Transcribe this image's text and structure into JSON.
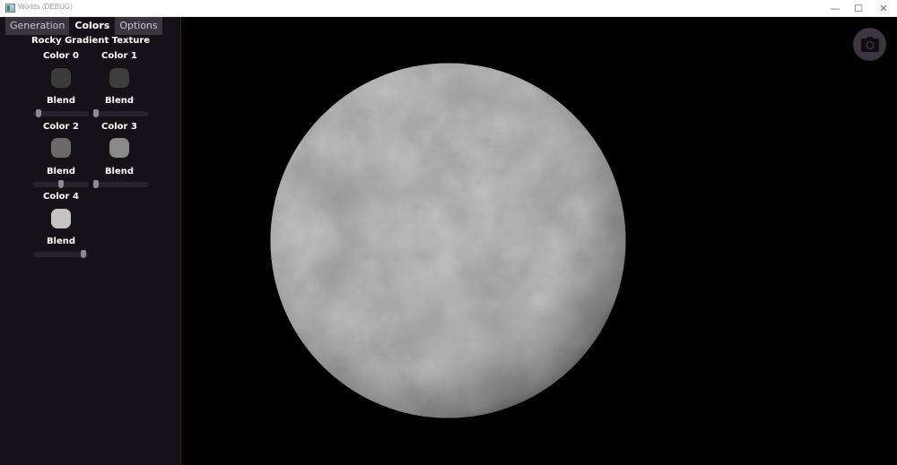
{
  "window": {
    "title": "Worlds (DEBUG)",
    "minimize_glyph": "—",
    "maximize_glyph": "☐",
    "close_glyph": "✕"
  },
  "tabs": [
    {
      "label": "Generation",
      "active": false
    },
    {
      "label": "Colors",
      "active": true
    },
    {
      "label": "Options",
      "active": false
    }
  ],
  "panel": {
    "title": "Rocky Gradient Texture",
    "colors": [
      {
        "label": "Color 0",
        "swatch": "#3a3a3a",
        "blend_label": "Blend",
        "blend": 0.05
      },
      {
        "label": "Color 1",
        "swatch": "#3d3d3d",
        "blend_label": "Blend",
        "blend": 0.02
      },
      {
        "label": "Color 2",
        "swatch": "#6a6a6a",
        "blend_label": "Blend",
        "blend": 0.5
      },
      {
        "label": "Color 3",
        "swatch": "#898989",
        "blend_label": "Blend",
        "blend": 0.02
      },
      {
        "label": "Color 4",
        "swatch": "#c4c4c4",
        "blend_label": "Blend",
        "blend": 0.95
      }
    ]
  },
  "viewport": {
    "camera_icon": "camera-icon",
    "planet_base_color": "#6c6c6c",
    "planet_highlight_color": "#b8b8b8"
  }
}
